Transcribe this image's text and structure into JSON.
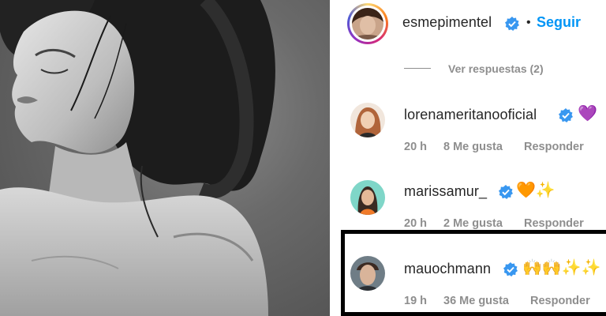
{
  "post_image": {
    "description_icon": "portrait-photo"
  },
  "header": {
    "username": "esmepimentel",
    "verified_icon": "verified-badge-icon",
    "separator": "•",
    "follow_label": "Seguir"
  },
  "previous_thread": {
    "view_replies": "Ver respuestas (2)"
  },
  "comments": [
    {
      "username": "lorenameritanooficial",
      "emoji": "💜",
      "time": "20 h",
      "likes": "8 Me gusta",
      "reply": "Responder"
    },
    {
      "username": "marissamur_",
      "emoji": "🧡✨",
      "time": "20 h",
      "likes": "2 Me gusta",
      "reply": "Responder"
    },
    {
      "username": "mauochmann",
      "emoji": "🙌🙌✨✨",
      "time": "19 h",
      "likes": "36 Me gusta",
      "reply": "Responder"
    }
  ],
  "colors": {
    "accent": "#0095f6",
    "verified": "#3897f0",
    "muted": "#8e8e8e",
    "text": "#262626",
    "highlight_border": "#000000"
  }
}
